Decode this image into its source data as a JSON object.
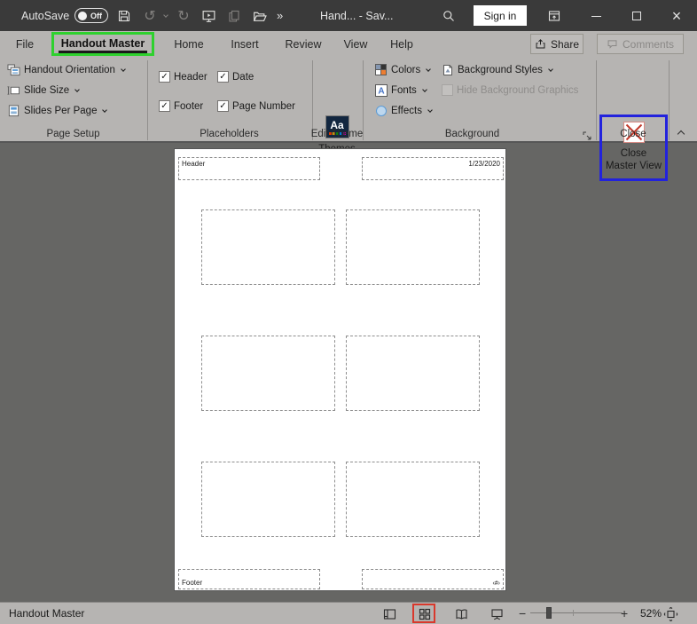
{
  "colors": {
    "titlebar_bg": "#3a3a3a",
    "ribbon_bg": "#b6b4b2",
    "workspace_bg": "#666664",
    "green_highlight": "#2ed12e",
    "blue_highlight": "#2222dd",
    "red_highlight": "#d9382c",
    "close_x_red": "#c0392b",
    "theme_tile_navy": "#12263f"
  },
  "icons": {
    "undo": "↺",
    "redo": "↻",
    "overflow_chevrons": "»",
    "close_window": "×",
    "check": "✓"
  },
  "titlebar": {
    "autosave_label": "AutoSave",
    "autosave_state": "Off",
    "title": "Hand... - Sav...",
    "sign_in": "Sign in"
  },
  "tabs": {
    "items": [
      "File",
      "Handout Master",
      "Home",
      "Insert",
      "Review",
      "View",
      "Help"
    ],
    "active": "Handout Master",
    "share": "Share",
    "comments": "Comments"
  },
  "ribbon": {
    "page_setup": {
      "label": "Page Setup",
      "buttons": [
        "Handout Orientation",
        "Slide Size",
        "Slides Per Page"
      ]
    },
    "placeholders": {
      "label": "Placeholders",
      "checkboxes": [
        {
          "label": "Header",
          "checked": true
        },
        {
          "label": "Date",
          "checked": true
        },
        {
          "label": "Footer",
          "checked": true
        },
        {
          "label": "Page Number",
          "checked": true
        }
      ]
    },
    "edit_theme": {
      "label": "Edit Theme",
      "themes_button": "Themes"
    },
    "background": {
      "label": "Background",
      "colors_button": "Colors",
      "fonts_button": "Fonts",
      "effects_button": "Effects",
      "background_styles_button": "Background Styles",
      "hide_background_graphics": "Hide Background Graphics"
    },
    "close": {
      "label": "Close",
      "button_line1": "Close",
      "button_line2": "Master View"
    }
  },
  "canvas": {
    "header_placeholder": "Header",
    "date_value": "1/23/2020",
    "footer_placeholder": "Footer",
    "page_number_placeholder": "‹#›",
    "slide_count": 6
  },
  "statusbar": {
    "status_text": "Handout Master",
    "zoom_minus": "−",
    "zoom_plus": "+",
    "zoom_level": "52%"
  }
}
